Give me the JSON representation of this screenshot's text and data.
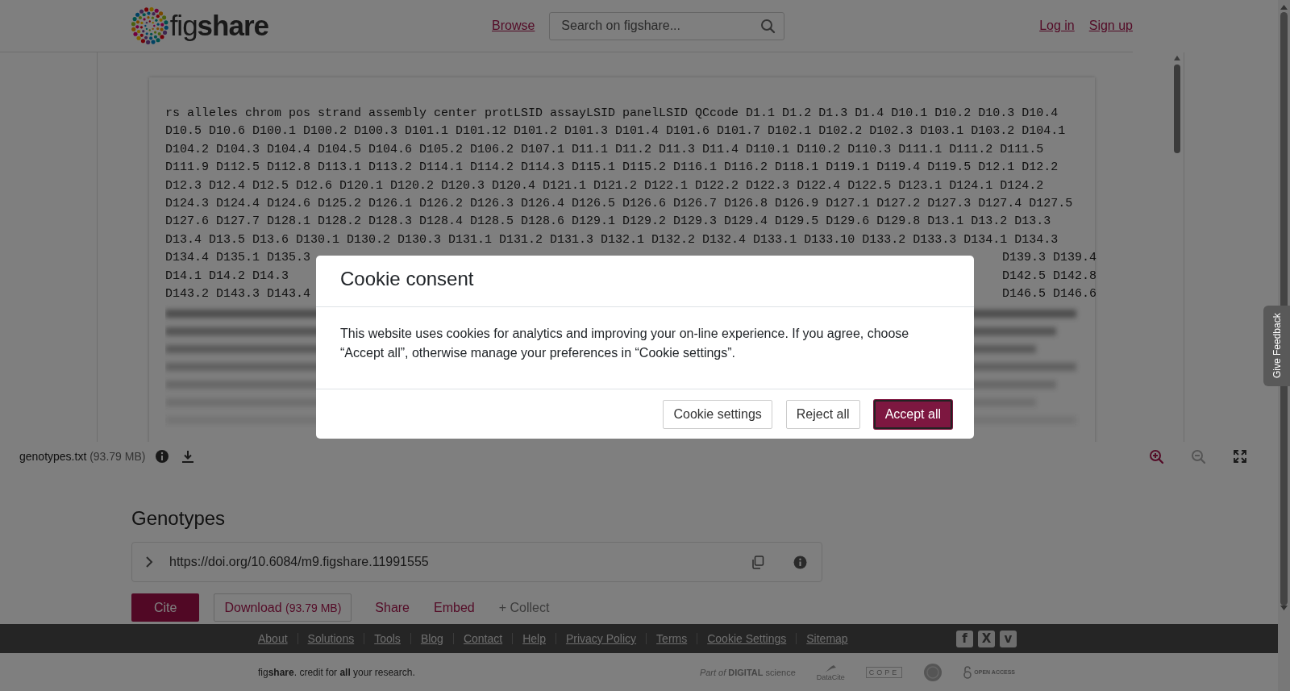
{
  "header": {
    "logo": "fig**share**",
    "nav_link": "Browse",
    "search": {
      "placeholder": "Search on figshare..."
    },
    "auth_links": [
      "Log in",
      "Sign up"
    ]
  },
  "viewer": {
    "lines": [
      "rs alleles chrom pos strand assembly center protLSID assayLSID panelLSID QCcode D1.1 D1.2 D1.3 D1.4 D10.1 D10.2 D10.3 D10.4",
      "D10.5 D10.6 D100.1 D100.2 D100.3 D101.1 D101.12 D101.2 D101.3 D101.4 D101.6 D101.7 D102.1 D102.2 D102.3 D103.1 D103.2 D104.1",
      "D104.2 D104.3 D104.4 D104.5 D104.6 D105.2 D106.2 D107.1 D11.1 D11.2 D11.3 D11.4 D110.1 D110.2 D110.3 D111.1 D111.2 D111.5",
      "D111.9 D112.5 D112.8 D113.1 D113.2 D114.1 D114.2 D114.3 D115.1 D115.2 D116.1 D116.2 D118.1 D119.1 D119.4 D119.5 D12.1 D12.2",
      "D12.3 D12.4 D12.5 D12.6 D120.1 D120.2 D120.3 D120.4 D121.1 D121.2 D122.1 D122.2 D122.3 D122.4 D122.5 D123.1 D124.1 D124.2",
      "D124.3 D124.4 D124.6 D125.2 D126.1 D126.2 D126.3 D126.4 D126.5 D126.6 D126.7 D126.8 D126.9 D127.1 D127.2 D127.3 D127.4 D127.5",
      "D127.6 D127.7 D128.1 D128.2 D128.3 D128.4 D128.5 D128.6 D129.1 D129.2 D129.3 D129.4 D129.5 D129.6 D129.8 D13.1 D13.2 D13.3",
      "D13.4 D13.5 D13.6 D130.1 D130.2 D130.3 D131.1 D131.2 D131.3 D132.1 D132.2 D132.4 D133.1 D133.10 D133.2 D133.3 D134.1 D134.3"
    ],
    "covered_lines": [
      {
        "left": "D134.4 D135.1 D135.3",
        "right": "D139.3 D139.4"
      },
      {
        "left": "D14.1 D14.2 D14.3",
        "right": "D142.5 D142.8"
      },
      {
        "left": "D143.2 D143.3 D143.4",
        "right": "D146.5 D146.6"
      }
    ],
    "file": {
      "name": "genotypes.txt",
      "size": "(93.79 MB)"
    },
    "controls": [
      {
        "kind": "zoom_in",
        "disabled": false
      },
      {
        "kind": "zoom_out",
        "disabled": true
      },
      {
        "kind": "fullscreen",
        "disabled": false
      }
    ]
  },
  "item": {
    "title": "Genotypes",
    "doi": "https://doi.org/10.6084/m9.figshare.11991555",
    "actions": [
      {
        "kind": "primary",
        "label": "Cite"
      },
      {
        "kind": "outline",
        "label": "Download",
        "note": "(93.79 MB)"
      },
      {
        "kind": "link",
        "label": "Share"
      },
      {
        "kind": "link",
        "label": "Embed"
      },
      {
        "kind": "muted",
        "label": "+ Collect"
      }
    ]
  },
  "footer": {
    "links": [
      "About",
      "Solutions",
      "Tools",
      "Blog",
      "Contact",
      "Help",
      "Privacy Policy",
      "Terms",
      "Cookie Settings",
      "Sitemap"
    ],
    "social": [
      "f",
      "X",
      "v"
    ],
    "tagline": "fig**share**. credit for **all** your research.",
    "partners": [
      {
        "kind": "digital_science",
        "label": "*Part of* **DIGITAL** science"
      },
      {
        "kind": "datacite",
        "label": "DataCite"
      },
      {
        "kind": "cope",
        "label": "COPE"
      },
      {
        "kind": "seal"
      },
      {
        "kind": "open_access",
        "label": "OPEN ACCESS"
      }
    ]
  },
  "feedback_tab": "Give Feedback",
  "cookie_dialog": {
    "title": "Cookie consent",
    "message": "This website uses cookies for analytics and improving your on-line experience. If you agree, choose “Accept all”, otherwise manage your preferences in “Cookie settings”.",
    "buttons": [
      {
        "label": "Cookie settings",
        "primary": false
      },
      {
        "label": "Reject all",
        "primary": false
      },
      {
        "label": "Accept all",
        "primary": true
      }
    ]
  }
}
